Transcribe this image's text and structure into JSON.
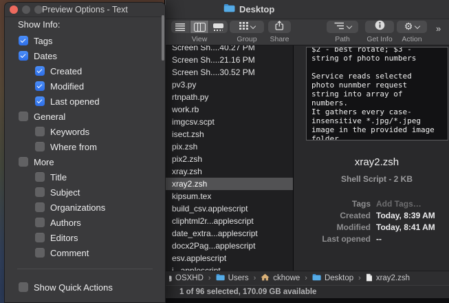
{
  "panel": {
    "title": "Preview Options - Text",
    "show_info_label": "Show Info:",
    "items": [
      {
        "label": "Tags",
        "checked": true,
        "indent": 0
      },
      {
        "label": "Dates",
        "checked": true,
        "indent": 0
      },
      {
        "label": "Created",
        "checked": true,
        "indent": 1
      },
      {
        "label": "Modified",
        "checked": true,
        "indent": 1
      },
      {
        "label": "Last opened",
        "checked": true,
        "indent": 1
      },
      {
        "label": "General",
        "checked": false,
        "indent": 0
      },
      {
        "label": "Keywords",
        "checked": false,
        "indent": 1
      },
      {
        "label": "Where from",
        "checked": false,
        "indent": 1
      },
      {
        "label": "More",
        "checked": false,
        "indent": 0
      },
      {
        "label": "Title",
        "checked": false,
        "indent": 1
      },
      {
        "label": "Subject",
        "checked": false,
        "indent": 1
      },
      {
        "label": "Organizations",
        "checked": false,
        "indent": 1
      },
      {
        "label": "Authors",
        "checked": false,
        "indent": 1
      },
      {
        "label": "Editors",
        "checked": false,
        "indent": 1
      },
      {
        "label": "Comment",
        "checked": false,
        "indent": 1
      }
    ],
    "footer_item": {
      "label": "Show Quick Actions",
      "checked": false
    }
  },
  "finder": {
    "title": "Desktop",
    "toolbar": {
      "view": {
        "label": "View"
      },
      "group": {
        "label": "Group"
      },
      "share": {
        "label": "Share"
      },
      "path": {
        "label": "Path"
      },
      "get_info": {
        "label": "Get Info"
      },
      "action": {
        "label": "Action"
      }
    },
    "icons": {
      "gear": "⚙",
      "overflow": "»"
    },
    "files": [
      {
        "name": "Screen Sh....40.27 PM"
      },
      {
        "name": "Screen Sh....21.16 PM"
      },
      {
        "name": "Screen Sh....30.52 PM"
      },
      {
        "name": "pv3.py"
      },
      {
        "name": "rtnpath.py"
      },
      {
        "name": "work.rb"
      },
      {
        "name": "imgcsv.scpt"
      },
      {
        "name": "isect.zsh"
      },
      {
        "name": "pix.zsh"
      },
      {
        "name": "pix2.zsh"
      },
      {
        "name": "xray.zsh"
      },
      {
        "name": "xray2.zsh",
        "selected": true
      },
      {
        "name": "kipsum.tex"
      },
      {
        "name": "build_csv.applescript"
      },
      {
        "name": "cliphtml2r...applescript"
      },
      {
        "name": "date_extra...applescript"
      },
      {
        "name": "docx2Pag...applescript"
      },
      {
        "name": "esv.applescript"
      },
      {
        "name": "i...applescript"
      }
    ],
    "preview": {
      "text_lines": [
        "$2 - best rotate; $3 -",
        "string of photo numbers",
        "",
        "Service reads selected",
        "photo nunmber request",
        "string into array of",
        "numbers.",
        "It gathers every case-",
        "insensitive *.jpg/*.jpeg",
        "image in the provided image",
        "folder."
      ],
      "file_name": "xray2.zsh",
      "file_kind": "Shell Script - 2 KB",
      "fields": [
        {
          "label": "Tags",
          "value": "Add Tags…",
          "dim": true
        },
        {
          "label": "Created",
          "value": "Today, 8:39 AM"
        },
        {
          "label": "Modified",
          "value": "Today, 8:41 AM"
        },
        {
          "label": "Last opened",
          "value": "--"
        }
      ]
    },
    "path_separator": "›",
    "path_items": [
      {
        "icon": "disk-icon",
        "label": "OSXHD",
        "clipped": true
      },
      {
        "icon": "folder-icon",
        "label": "Users"
      },
      {
        "icon": "home-icon",
        "label": "ckhowe"
      },
      {
        "icon": "folder-icon",
        "label": "Desktop"
      },
      {
        "icon": "file-icon",
        "label": "xray2.zsh"
      }
    ],
    "status": "1 of 96 selected, 170.09 GB available"
  },
  "colors": {
    "accent_blue": "#377af5",
    "selection_gray": "#525254",
    "folder_blue": "#4fa5e2",
    "close_red": "#ee6a5e"
  }
}
